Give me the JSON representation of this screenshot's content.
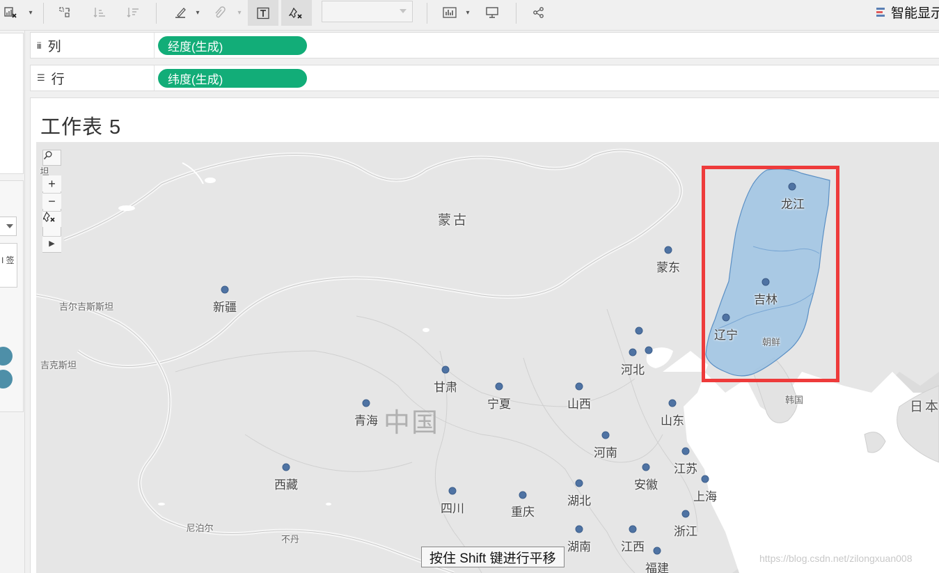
{
  "toolbar": {
    "left_icon": "clear-sheet-icon",
    "buttons": [
      {
        "icon": "swap-rows-columns-icon"
      },
      {
        "icon": "sort-ascending-icon"
      },
      {
        "icon": "sort-descending-icon"
      },
      {
        "icon": "highlight-pen-icon"
      },
      {
        "icon": "paperclip-icon"
      },
      {
        "icon": "show-title-icon",
        "glyph": "T"
      },
      {
        "icon": "clear-highlight-icon"
      },
      {
        "icon": "fit-chart-icon"
      },
      {
        "icon": "presentation-icon"
      },
      {
        "icon": "share-icon"
      }
    ],
    "show_me_label": "智能显示"
  },
  "shelves": {
    "columns": {
      "label": "列",
      "pill": "经度(生成)"
    },
    "rows": {
      "label": "行",
      "pill": "纬度(生成)"
    }
  },
  "sheet": {
    "title": "工作表 5"
  },
  "map": {
    "countries": [
      {
        "name": "蒙古",
        "size": "big"
      },
      {
        "name": "中国",
        "size": "huge"
      },
      {
        "name": "吉尔吉斯斯坦",
        "size": "sm"
      },
      {
        "name": "吉克斯坦",
        "size": "sm"
      },
      {
        "name": "尼泊尔",
        "size": "sm"
      },
      {
        "name": "不丹",
        "size": "sm"
      },
      {
        "name": "朝鲜",
        "size": "sm"
      },
      {
        "name": "韩国",
        "size": "sm"
      },
      {
        "name": "日本",
        "size": "big"
      },
      {
        "name": "坦",
        "size": "sm"
      }
    ],
    "provinces": [
      {
        "name": "龙江",
        "selected": true
      },
      {
        "name": "蒙东",
        "selected": false
      },
      {
        "name": "吉林",
        "selected": true
      },
      {
        "name": "辽宁",
        "selected": true
      },
      {
        "name": "新疆",
        "selected": false
      },
      {
        "name": "河北",
        "selected": false
      },
      {
        "name": "甘肃",
        "selected": false
      },
      {
        "name": "宁夏",
        "selected": false
      },
      {
        "name": "山西",
        "selected": false
      },
      {
        "name": "青海",
        "selected": false
      },
      {
        "name": "山东",
        "selected": false
      },
      {
        "name": "河南",
        "selected": false
      },
      {
        "name": "江苏",
        "selected": false
      },
      {
        "name": "西藏",
        "selected": false
      },
      {
        "name": "安徽",
        "selected": false
      },
      {
        "name": "上海",
        "selected": false
      },
      {
        "name": "四川",
        "selected": false
      },
      {
        "name": "重庆",
        "selected": false
      },
      {
        "name": "湖北",
        "selected": false
      },
      {
        "name": "浙江",
        "selected": false
      },
      {
        "name": "湖南",
        "selected": false
      },
      {
        "name": "江西",
        "selected": false
      },
      {
        "name": "福建",
        "selected": false
      }
    ],
    "controls": {
      "search_icon": "magnifier-icon",
      "zoom_in": "+",
      "zoom_out": "−",
      "reset_icon": "pin-clear-icon",
      "expand_icon": "triangle-right-icon"
    },
    "selection_color": "#9dc3e3",
    "highlight_color": "#ee3b3b"
  },
  "hint": "按住 Shift 键进行平移",
  "watermark": "https://blog.csdn.net/zilongxuan008",
  "left_panel": {
    "card_text": "I 签"
  },
  "colors": {
    "pill": "#12ad78",
    "dot": "#4f73a3",
    "left_dot": "#4e8fa8"
  }
}
